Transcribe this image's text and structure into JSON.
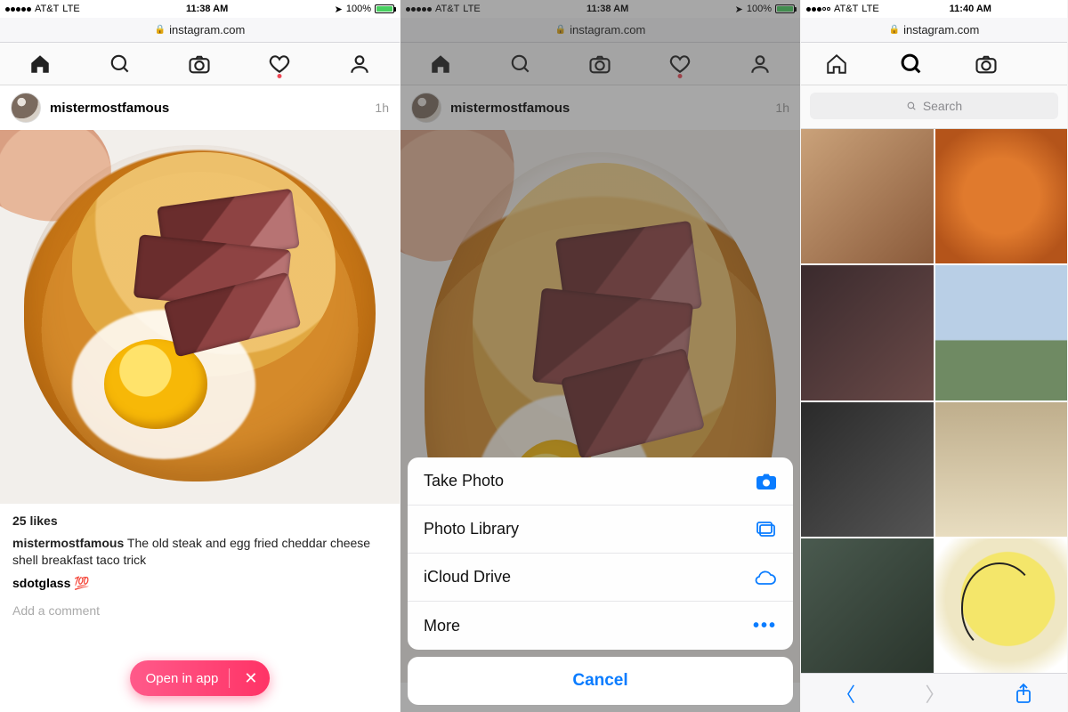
{
  "status": {
    "carrier": "AT&T",
    "network": "LTE",
    "time1": "11:38 AM",
    "time2": "11:38 AM",
    "time3": "11:40 AM",
    "battery": "100%"
  },
  "address": {
    "host": "instagram.com"
  },
  "post": {
    "username": "mistermostfamous",
    "age": "1h",
    "likes": "25 likes",
    "caption_user": "mistermostfamous",
    "caption_text": " The old steak and egg fried cheddar cheese shell breakfast taco trick",
    "comment_user": "sdotglass",
    "comment_emoji": "💯",
    "add_comment": "Add a comment",
    "caption_dimmed": "cheddar cheese shell breakfast taco trick"
  },
  "pill": {
    "label": "Open in app"
  },
  "sheet": {
    "take_photo": "Take Photo",
    "photo_library": "Photo Library",
    "icloud": "iCloud Drive",
    "more": "More",
    "cancel": "Cancel"
  },
  "search": {
    "placeholder": "Search"
  }
}
